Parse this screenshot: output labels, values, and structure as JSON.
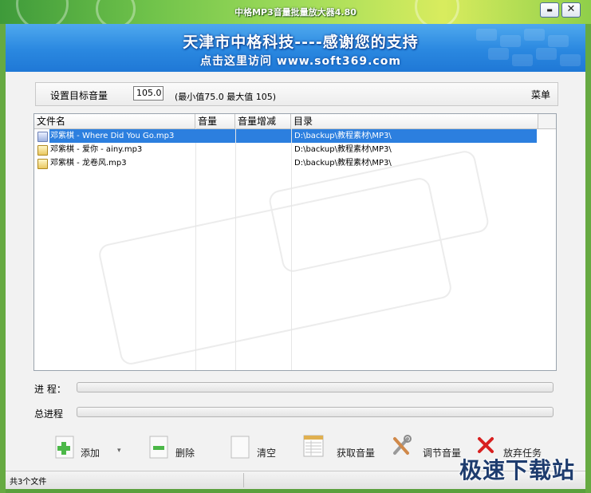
{
  "window": {
    "title": "中格MP3音量批量放大器4.80",
    "minimize_glyph": "▬",
    "close_glyph": "✕"
  },
  "banner": {
    "title": "天津市中格科技----感谢您的支持",
    "link": "点击这里访问 www.soft369.com"
  },
  "toolbar": {
    "target_label": "设置目标音量",
    "target_value": "105.0",
    "range_text": "(最小值75.0  最大值 105)",
    "menu_label": "菜单"
  },
  "file_list": {
    "columns": [
      "文件名",
      "音量",
      "音量增减",
      "目录"
    ],
    "rows": [
      {
        "name": "邓紫棋 - Where Did You Go.mp3",
        "volume": "",
        "gain": "",
        "directory": "D:\\backup\\教程素材\\MP3\\",
        "selected": true
      },
      {
        "name": "邓紫棋 - 爱你 - ainy.mp3",
        "volume": "",
        "gain": "",
        "directory": "D:\\backup\\教程素材\\MP3\\",
        "selected": false
      },
      {
        "name": "邓紫棋 - 龙卷风.mp3",
        "volume": "",
        "gain": "",
        "directory": "D:\\backup\\教程素材\\MP3\\",
        "selected": false
      }
    ]
  },
  "progress": {
    "current_label": "进   程：",
    "current_value": 0,
    "total_label": "总进程",
    "total_value": 0
  },
  "actions": {
    "add": "添加",
    "delete": "删除",
    "clear": "清空",
    "get_volume": "获取音量",
    "adjust_volume": "调节音量",
    "abort": "放弃任务"
  },
  "status": {
    "file_count": "共3个文件"
  },
  "watermark": {
    "text": "极速下载站"
  },
  "colors": {
    "selection": "#2c7fdf",
    "banner": "#2a88e0",
    "frame": "#66aa42"
  }
}
